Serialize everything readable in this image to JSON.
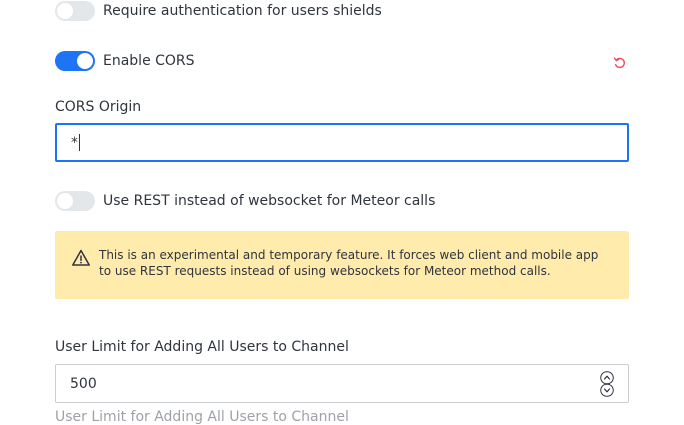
{
  "settings": {
    "require_auth_shields": {
      "label": "Require authentication for users shields",
      "enabled": false
    },
    "enable_cors": {
      "label": "Enable CORS",
      "enabled": true
    },
    "cors_origin": {
      "label": "CORS Origin",
      "value": "*"
    },
    "use_rest": {
      "label": "Use REST instead of websocket for Meteor calls",
      "enabled": false
    },
    "warning": {
      "text": "This is an experimental and temporary feature. It forces web client and mobile app to use REST requests instead of using websockets for Meteor method calls."
    },
    "user_limit": {
      "label": "User Limit for Adding All Users to Channel",
      "value": "500",
      "hint": "User Limit for Adding All Users to Channel"
    }
  },
  "colors": {
    "accent": "#1d74f5",
    "warning_bg": "#ffecad",
    "reset_icon": "#f5455c"
  },
  "icons": {
    "reset": "reset-icon",
    "warning": "warning-icon",
    "spinner": "number-spinner-icon"
  }
}
